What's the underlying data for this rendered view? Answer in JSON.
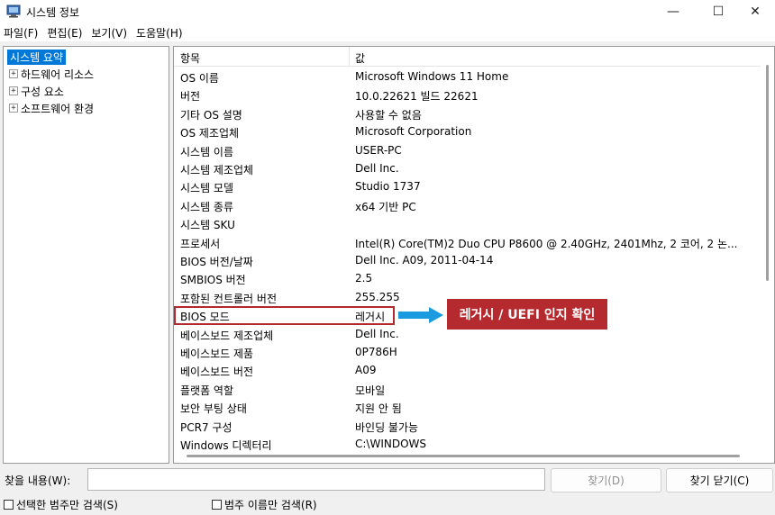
{
  "window": {
    "title": "시스템 정보",
    "min_glyph": "—",
    "max_glyph": "☐",
    "close_glyph": "✕"
  },
  "menu": [
    "파일(F)",
    "편집(E)",
    "보기(V)",
    "도움말(H)"
  ],
  "tree": {
    "root": "시스템 요약",
    "children": [
      "하드웨어 리소스",
      "구성 요소",
      "소프트웨어 환경"
    ],
    "expander_glyph": "+"
  },
  "table": {
    "headers": {
      "item": "항목",
      "value": "값"
    },
    "rows": [
      {
        "item": "OS 이름",
        "value": "Microsoft Windows 11 Home"
      },
      {
        "item": "버전",
        "value": "10.0.22621 빌드 22621"
      },
      {
        "item": "기타 OS 설명",
        "value": "사용할 수 없음"
      },
      {
        "item": "OS 제조업체",
        "value": "Microsoft Corporation"
      },
      {
        "item": "시스템 이름",
        "value": "USER-PC"
      },
      {
        "item": "시스템 제조업체",
        "value": "Dell Inc."
      },
      {
        "item": "시스템 모델",
        "value": "Studio 1737"
      },
      {
        "item": "시스템 종류",
        "value": "x64 기반 PC"
      },
      {
        "item": "시스템 SKU",
        "value": ""
      },
      {
        "item": "프로세서",
        "value": "Intel(R) Core(TM)2 Duo CPU     P8600  @ 2.40GHz, 2401Mhz, 2 코어, 2 논..."
      },
      {
        "item": "BIOS 버전/날짜",
        "value": "Dell Inc. A09, 2011-04-14"
      },
      {
        "item": "SMBIOS 버전",
        "value": "2.5"
      },
      {
        "item": "포함된 컨트롤러 버전",
        "value": "255.255"
      },
      {
        "item": "BIOS 모드",
        "value": "레거시"
      },
      {
        "item": "베이스보드 제조업체",
        "value": "Dell Inc."
      },
      {
        "item": "베이스보드 제품",
        "value": "0P786H"
      },
      {
        "item": "베이스보드 버전",
        "value": "A09"
      },
      {
        "item": "플랫폼 역할",
        "value": "모바일"
      },
      {
        "item": "보안 부팅 상태",
        "value": "지원 안 됨"
      },
      {
        "item": "PCR7 구성",
        "value": "바인딩 불가능"
      },
      {
        "item": "Windows 디렉터리",
        "value": "C:\\WINDOWS"
      }
    ]
  },
  "annotation": {
    "callout": "레거시 / UEFI 인지 확인",
    "box_color": "#b3282d",
    "callout_color": "#b52a2e",
    "arrow_color": "#1a9be0"
  },
  "find": {
    "label": "찾을 내용(W):",
    "input_value": "",
    "find_button": "찾기(D)",
    "close_button": "찾기 닫기(C)",
    "check_selected_only": "선택한 범주만 검색(S)",
    "check_names_only": "범주 이름만 검색(R)"
  }
}
